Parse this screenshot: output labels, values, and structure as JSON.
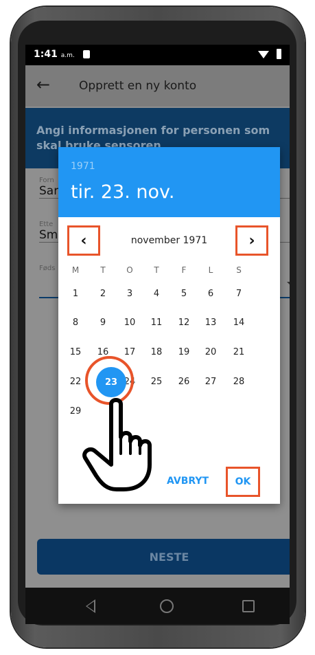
{
  "status_bar": {
    "time": "1:41",
    "ampm": "a.m."
  },
  "app_bar": {
    "title": "Opprett en ny konto"
  },
  "banner": {
    "text": "Angi informasjonen for personen som skal bruke sensoren"
  },
  "form": {
    "first_name_label": "Forn",
    "first_name_value": "Sar",
    "last_name_label": "Ette",
    "last_name_value": "Sm",
    "birth_label": "Føds"
  },
  "next_button": "NESTE",
  "date_picker": {
    "year": "1971",
    "selected_date": "tir. 23. nov.",
    "month_label": "november 1971",
    "prev_icon": "chevron-left-icon",
    "next_icon": "chevron-right-icon",
    "weekdays": [
      "M",
      "T",
      "O",
      "T",
      "F",
      "L",
      "S"
    ],
    "weeks": [
      [
        "1",
        "2",
        "3",
        "4",
        "5",
        "6",
        "7"
      ],
      [
        "8",
        "9",
        "10",
        "11",
        "12",
        "13",
        "14"
      ],
      [
        "15",
        "16",
        "17",
        "18",
        "19",
        "20",
        "21"
      ],
      [
        "22",
        "23",
        "24",
        "25",
        "26",
        "27",
        "28"
      ],
      [
        "29",
        "",
        "",
        "",
        "",
        "",
        ""
      ]
    ],
    "selected_day": "23",
    "cancel_label": "AVBRYT",
    "ok_label": "OK"
  },
  "highlight_color": "#e8542a",
  "accent_color": "#2196f3"
}
